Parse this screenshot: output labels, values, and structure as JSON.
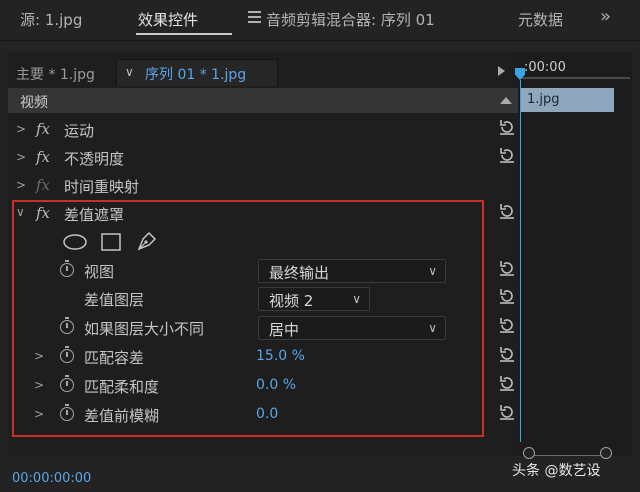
{
  "tabs": [
    {
      "label": "源: 1.jpg"
    },
    {
      "label": "效果控件"
    },
    {
      "label": "音频剪辑混合器: 序列 01"
    },
    {
      "label": "元数据"
    }
  ],
  "more_glyph": "»",
  "source_bar": {
    "master": "主要 * 1.jpg",
    "sequence": "序列 01 * 1.jpg"
  },
  "section": {
    "title": "视频"
  },
  "effects": [
    {
      "label": "运动"
    },
    {
      "label": "不透明度"
    },
    {
      "label": "时间重映射"
    },
    {
      "label": "差值遮罩"
    }
  ],
  "fx_glyph": "fx",
  "properties": {
    "view": {
      "label": "视图",
      "value": "最终输出"
    },
    "diff_layer": {
      "label": "差值图层",
      "value": "视频 2"
    },
    "if_size_differs": {
      "label": "如果图层大小不同",
      "value": "居中"
    },
    "match_tolerance": {
      "label": "匹配容差",
      "value": "15.0 %"
    },
    "match_softness": {
      "label": "匹配柔和度",
      "value": "0.0 %"
    },
    "blur_before": {
      "label": "差值前模糊",
      "value": "0.0"
    }
  },
  "timeline": {
    "time": ":00:00",
    "clip": "1.jpg"
  },
  "footer": {
    "timecode": "00:00:00:00"
  },
  "watermark": "头条 @数艺设",
  "colors": {
    "accent": "#5aa6e8",
    "highlight_box": "#c8302c",
    "clip": "#8fa7bd"
  }
}
